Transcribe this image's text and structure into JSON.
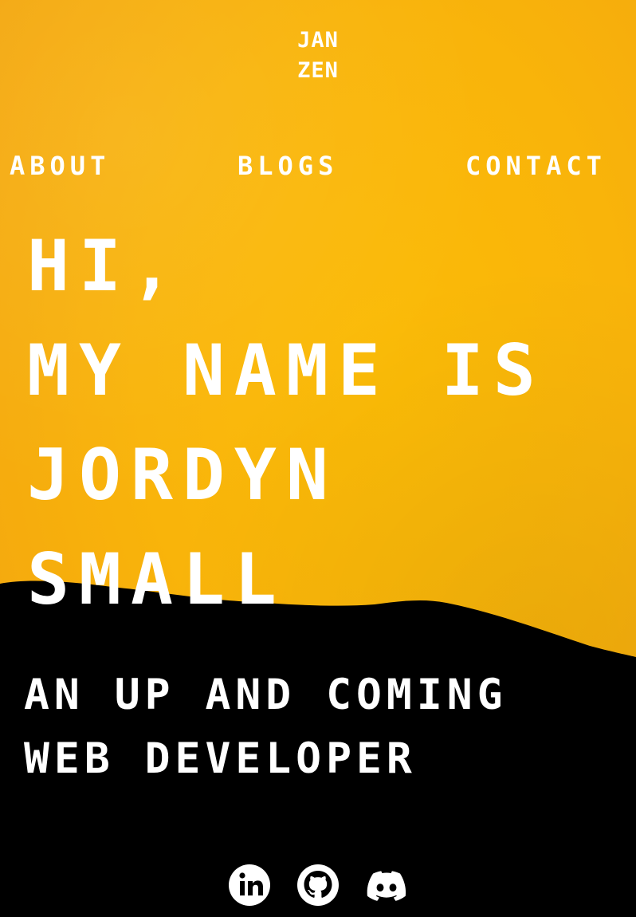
{
  "logo": {
    "line1": "JAN",
    "line2": "ZEN"
  },
  "nav": {
    "about": "ABOUT",
    "blogs": "BLOGS",
    "contact": "CONTACT"
  },
  "hero": {
    "line1": "HI,",
    "line2": "MY NAME IS",
    "line3": "JORDYN",
    "line4": "SMALL"
  },
  "subtitle": {
    "line1": "AN UP AND COMING",
    "line2": "WEB DEVELOPER"
  },
  "socials": [
    {
      "icon": "linkedin-icon"
    },
    {
      "icon": "github-icon"
    },
    {
      "icon": "discord-icon"
    }
  ],
  "colors": {
    "background": "#f9b40a",
    "hill": "#000000",
    "text": "#ffffff"
  }
}
